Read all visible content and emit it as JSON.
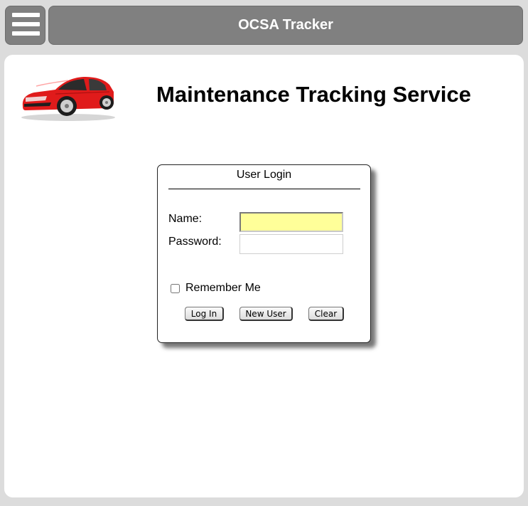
{
  "header": {
    "menu_icon": "hamburger-menu-icon",
    "title": "OCSA Tracker"
  },
  "main": {
    "logo": "red-car-image",
    "heading": "Maintenance Tracking Service"
  },
  "login": {
    "title": "User Login",
    "name_label": "Name:",
    "name_value": "",
    "password_label": "Password:",
    "password_value": "",
    "remember_label": "Remember Me",
    "remember_checked": false,
    "buttons": {
      "login": "Log In",
      "new_user": "New User",
      "clear": "Clear"
    }
  },
  "colors": {
    "header_bg": "#808080",
    "page_bg": "#dcdcdc",
    "name_field_bg": "#ffff99",
    "car_color": "#e01b1b"
  }
}
